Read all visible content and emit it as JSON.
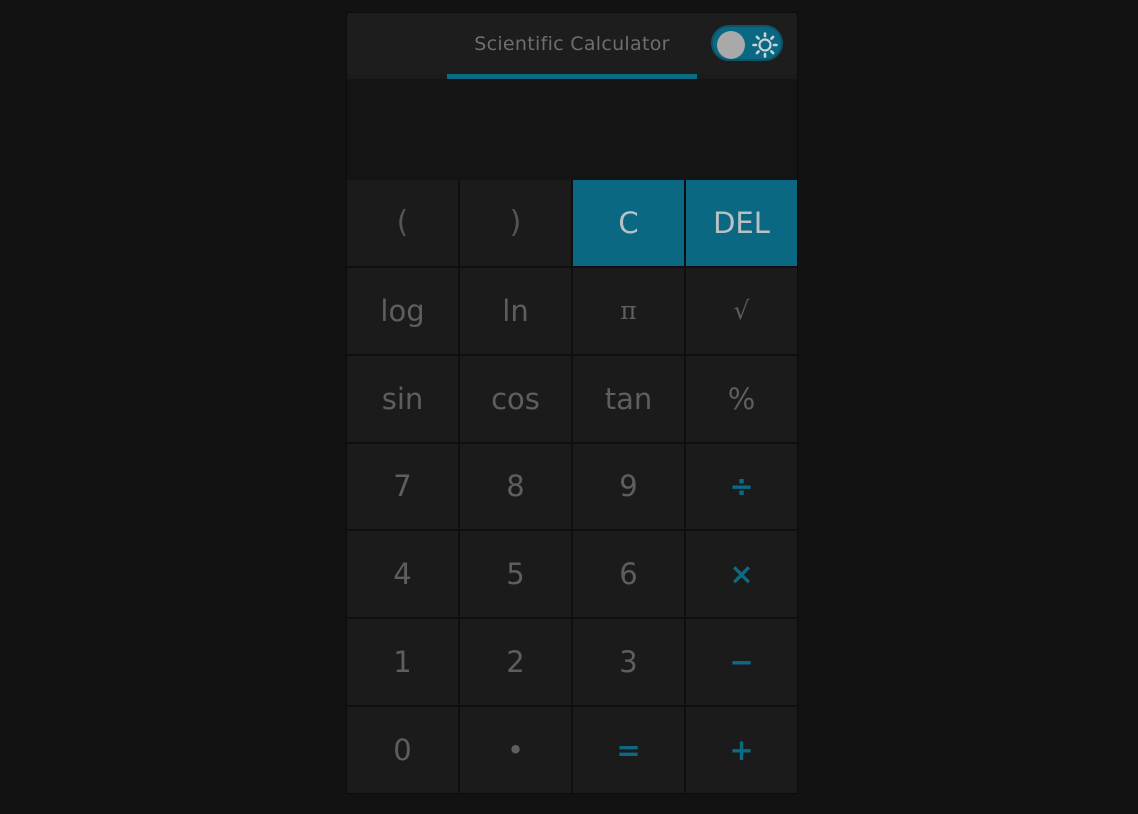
{
  "header": {
    "title": "Scientific Calculator",
    "theme_toggle_state": "dark"
  },
  "display": {
    "value": ""
  },
  "keys": [
    {
      "label": "(",
      "kind": "paren",
      "name": "open-paren-button"
    },
    {
      "label": ")",
      "kind": "paren",
      "name": "close-paren-button"
    },
    {
      "label": "C",
      "kind": "accent",
      "name": "clear-button"
    },
    {
      "label": "DEL",
      "kind": "accent",
      "name": "delete-button"
    },
    {
      "label": "log",
      "kind": "func",
      "name": "log-button"
    },
    {
      "label": "ln",
      "kind": "func",
      "name": "ln-button"
    },
    {
      "label": "π",
      "kind": "serif",
      "name": "pi-button"
    },
    {
      "label": "√",
      "kind": "serif",
      "name": "sqrt-button"
    },
    {
      "label": "sin",
      "kind": "func",
      "name": "sin-button"
    },
    {
      "label": "cos",
      "kind": "func",
      "name": "cos-button"
    },
    {
      "label": "tan",
      "kind": "func",
      "name": "tan-button"
    },
    {
      "label": "%",
      "kind": "func",
      "name": "percent-button"
    },
    {
      "label": "7",
      "kind": "digit",
      "name": "digit-7-button"
    },
    {
      "label": "8",
      "kind": "digit",
      "name": "digit-8-button"
    },
    {
      "label": "9",
      "kind": "digit",
      "name": "digit-9-button"
    },
    {
      "label": "÷",
      "kind": "op",
      "name": "divide-button"
    },
    {
      "label": "4",
      "kind": "digit",
      "name": "digit-4-button"
    },
    {
      "label": "5",
      "kind": "digit",
      "name": "digit-5-button"
    },
    {
      "label": "6",
      "kind": "digit",
      "name": "digit-6-button"
    },
    {
      "label": "×",
      "kind": "op",
      "name": "multiply-button"
    },
    {
      "label": "1",
      "kind": "digit",
      "name": "digit-1-button"
    },
    {
      "label": "2",
      "kind": "digit",
      "name": "digit-2-button"
    },
    {
      "label": "3",
      "kind": "digit",
      "name": "digit-3-button"
    },
    {
      "label": "−",
      "kind": "op",
      "name": "subtract-button"
    },
    {
      "label": "0",
      "kind": "digit",
      "name": "digit-0-button"
    },
    {
      "label": "•",
      "kind": "digit",
      "name": "decimal-button"
    },
    {
      "label": "=",
      "kind": "op",
      "name": "equals-button"
    },
    {
      "label": "+",
      "kind": "op",
      "name": "add-button"
    }
  ],
  "colors": {
    "accent": "#0a6882",
    "background": "#121212",
    "key": "#1b1b1b",
    "key_text": "#5e5e5e"
  },
  "icons": {
    "toggle": "sun-icon"
  }
}
